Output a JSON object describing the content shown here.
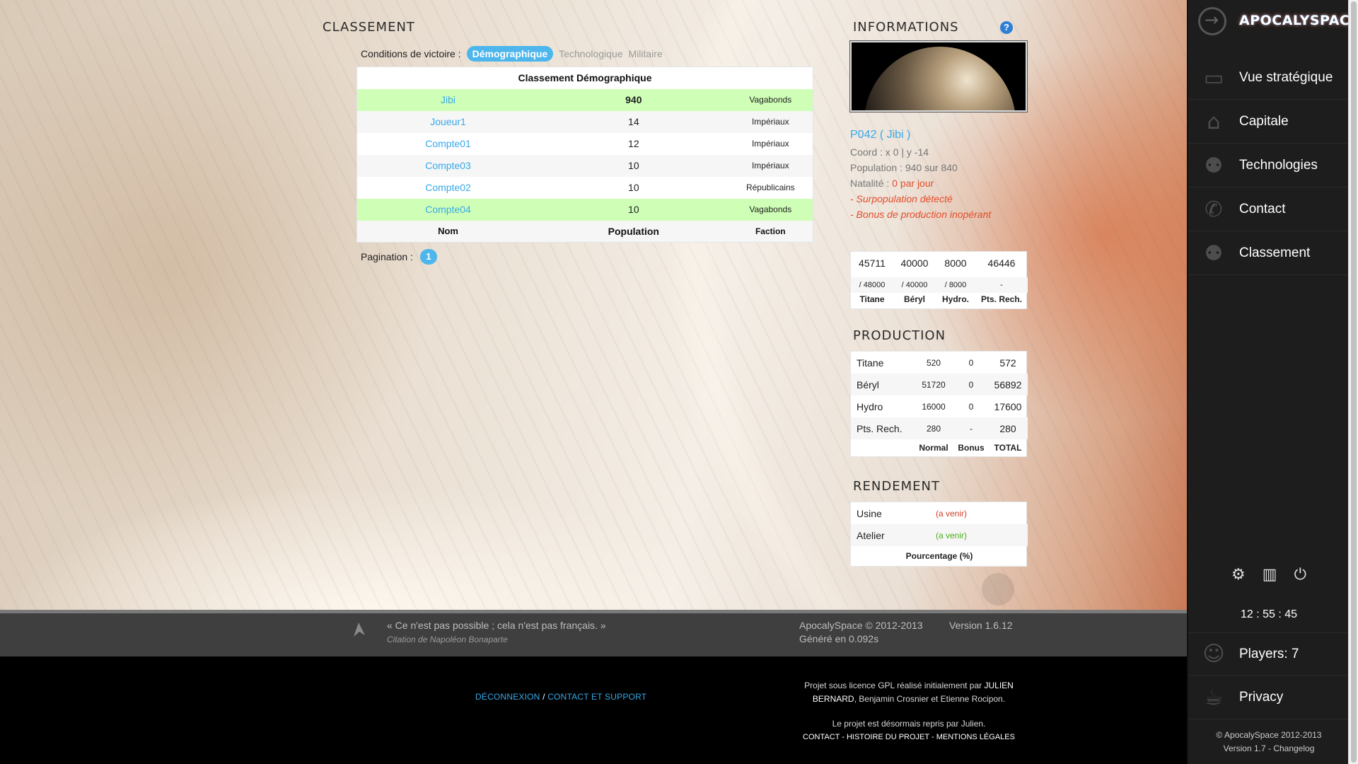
{
  "classement": {
    "title": "CLASSEMENT",
    "conditions_label": "Conditions de victoire :",
    "tabs": [
      {
        "label": "Démographique",
        "active": true
      },
      {
        "label": "Technologique",
        "active": false
      },
      {
        "label": "Militaire",
        "active": false
      }
    ],
    "table_title": "Classement Démographique",
    "rows": [
      {
        "nom": "Jibi",
        "population": "940",
        "faction": "Vagabonds",
        "highlight": true,
        "bold": true
      },
      {
        "nom": "Joueur1",
        "population": "14",
        "faction": "Impériaux",
        "highlight": false
      },
      {
        "nom": "Compte01",
        "population": "12",
        "faction": "Impériaux",
        "highlight": false
      },
      {
        "nom": "Compte03",
        "population": "10",
        "faction": "Impériaux",
        "highlight": false
      },
      {
        "nom": "Compte02",
        "population": "10",
        "faction": "Républicains",
        "highlight": false
      },
      {
        "nom": "Compte04",
        "population": "10",
        "faction": "Vagabonds",
        "highlight": true
      }
    ],
    "columns": {
      "nom": "Nom",
      "population": "Population",
      "faction": "Faction"
    },
    "pagination_label": "Pagination :",
    "pagination_pages": [
      "1"
    ]
  },
  "informations": {
    "title": "INFORMATIONS",
    "help": "?",
    "planet_name": "P042 ( Jibi )",
    "coord": "Coord : x 0 | y -14",
    "population": "Population : 940 sur 840",
    "natalite_label": "Natalité :",
    "natalite_value": "0 par jour",
    "warnings": [
      "- Surpopulation détecté",
      "- Bonus de production inopérant"
    ]
  },
  "resources": {
    "values": [
      "45711",
      "40000",
      "8000",
      "46446"
    ],
    "max": [
      "/ 48000",
      "/ 40000",
      "/ 8000",
      "-"
    ],
    "labels": [
      "Titane",
      "Béryl",
      "Hydro.",
      "Pts. Rech."
    ]
  },
  "production": {
    "title": "PRODUCTION",
    "rows": [
      {
        "name": "Titane",
        "normal": "520",
        "bonus": "0",
        "total": "572"
      },
      {
        "name": "Béryl",
        "normal": "51720",
        "bonus": "0",
        "total": "56892"
      },
      {
        "name": "Hydro",
        "normal": "16000",
        "bonus": "0",
        "total": "17600"
      },
      {
        "name": "Pts. Rech.",
        "normal": "280",
        "bonus": "-",
        "total": "280"
      }
    ],
    "headers": {
      "normal": "Normal",
      "bonus": "Bonus",
      "total": "TOTAL"
    }
  },
  "rendement": {
    "title": "RENDEMENT",
    "rows": [
      {
        "name": "Usine",
        "value": "(a venir)",
        "color": "#d0402a"
      },
      {
        "name": "Atelier",
        "value": "(a venir)",
        "color": "#4caf1a"
      }
    ],
    "footer": "Pourcentage (%)"
  },
  "footer": {
    "quote": "« Ce n'est pas possible ; cela n'est pas français. »",
    "quote_author": "Citation de Napoléon Bonaparte",
    "copyright": "ApocalySpace © 2012-2013",
    "version": "Version 1.6.12",
    "generated": "Généré en 0.092s",
    "link_logout": "DÉCONNEXION",
    "link_sep": "/",
    "link_contact": "CONTACT ET SUPPORT",
    "credits_1": "Projet sous licence GPL réalisé initialement par",
    "credits_name1": "JULIEN BERNARD",
    "credits_2": ", Benjamin Crosnier et Etienne Rocipon.",
    "credits_3": "Le projet est désormais repris par Julien.",
    "links2": "CONTACT - HISTOIRE DU PROJET - MENTIONS LÉGALES"
  },
  "sidebar": {
    "logo": "APOCALYSPACE",
    "items": [
      {
        "label": "Vue stratégique",
        "icon": "monitor-icon"
      },
      {
        "label": "Capitale",
        "icon": "home-icon"
      },
      {
        "label": "Technologies",
        "icon": "users-icon"
      },
      {
        "label": "Contact",
        "icon": "phone-icon"
      },
      {
        "label": "Classement",
        "icon": "users-icon"
      }
    ],
    "clock": "12 : 55 : 45",
    "players": "Players: 7",
    "privacy": "Privacy",
    "copyright": "© ApocalySpace 2012-2013",
    "version": "Version 1.7 - Changelog"
  }
}
